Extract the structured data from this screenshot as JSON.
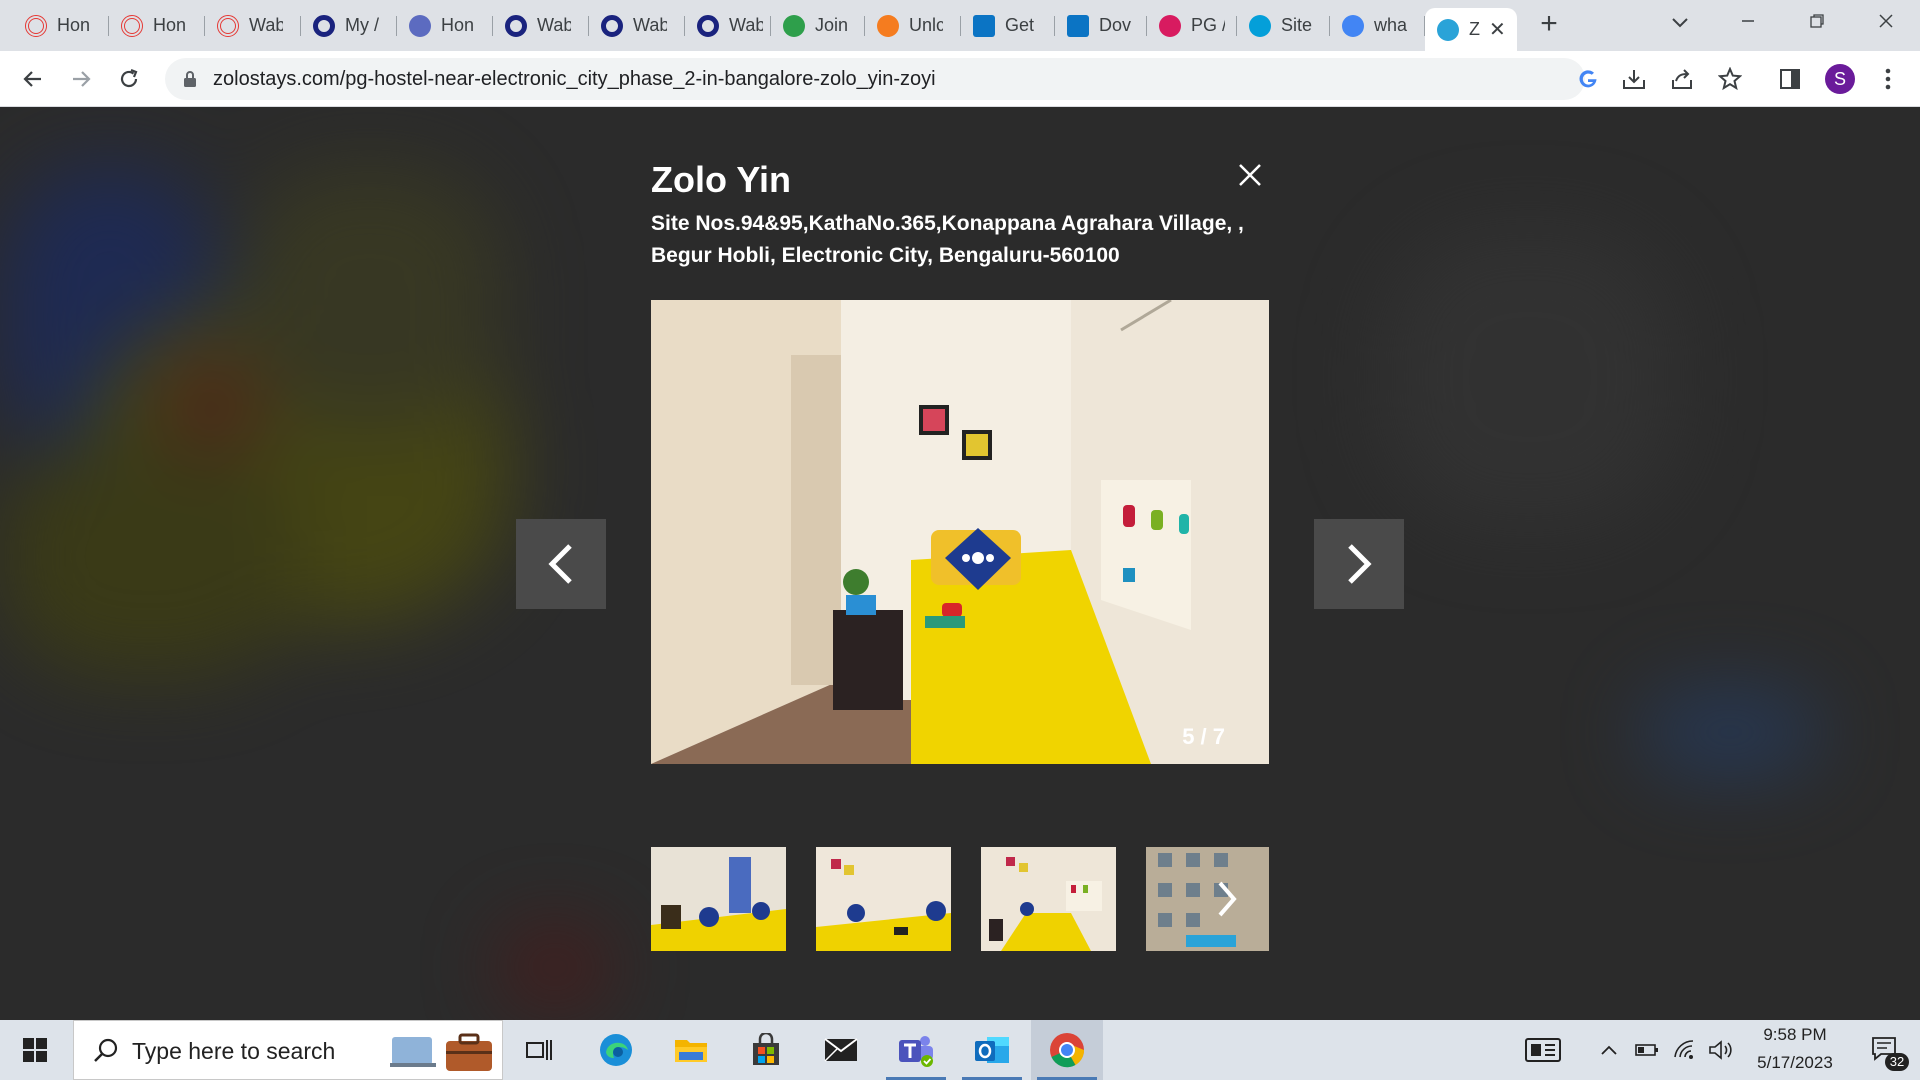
{
  "browser": {
    "tabs": [
      {
        "title": "Hon",
        "icon": "target-icon",
        "color": "#e53935"
      },
      {
        "title": "Hon",
        "icon": "target-icon",
        "color": "#e53935"
      },
      {
        "title": "Wab",
        "icon": "target-icon",
        "color": "#e53935"
      },
      {
        "title": "My /",
        "icon": "ring-icon",
        "color": "#1a237e"
      },
      {
        "title": "Hon",
        "icon": "swirl-icon",
        "color": "#5c6bc0"
      },
      {
        "title": "Wab",
        "icon": "ring-icon",
        "color": "#1a237e"
      },
      {
        "title": "Wab",
        "icon": "ring-icon",
        "color": "#1a237e"
      },
      {
        "title": "Wab",
        "icon": "ring-icon",
        "color": "#1a237e"
      },
      {
        "title": "Join",
        "icon": "s-badge-icon",
        "color": "#2e9f4b"
      },
      {
        "title": "Unlc",
        "icon": "orange-dot-icon",
        "color": "#f57c1f"
      },
      {
        "title": "Get",
        "icon": "video-icon",
        "color": "#0b74c4"
      },
      {
        "title": "Dov",
        "icon": "video-icon",
        "color": "#0b74c4"
      },
      {
        "title": "PG /",
        "icon": "c-logo-icon",
        "color": "#d81b60"
      },
      {
        "title": "Site",
        "icon": "cisco-icon",
        "color": "#049fd9"
      },
      {
        "title": "wha",
        "icon": "google-icon",
        "color": "#4285f4"
      },
      {
        "title": "Z",
        "icon": "zolo-icon",
        "color": "#2aa3d8"
      }
    ],
    "url": "zolostays.com/pg-hostel-near-electronic_city_phase_2-in-bangalore-zolo_yin-zoyi",
    "profile_initial": "S"
  },
  "gallery": {
    "title": "Zolo Yin",
    "address": "Site Nos.94&95,KathaNo.365,Konappana Agrahara Village, , Begur Hobli, Electronic City, Bengaluru-560100",
    "counter": "5 / 7",
    "current_index": 5,
    "total": 7,
    "thumbnails": [
      "room-photo-1",
      "room-photo-2",
      "room-photo-3",
      "building-photo-4"
    ]
  },
  "taskbar": {
    "search_placeholder": "Type here to search",
    "time": "9:58 PM",
    "date": "5/17/2023",
    "notification_count": "32"
  },
  "colors": {
    "accent_yellow": "#f0d400",
    "overlay_bg": "#2b2b2b",
    "arrow_bg": "#4a4a4a"
  }
}
